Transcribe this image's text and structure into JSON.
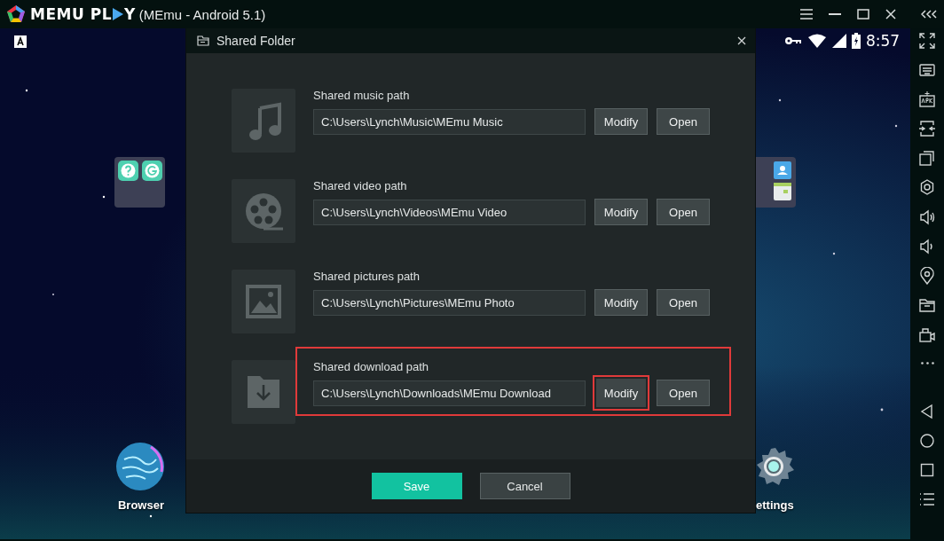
{
  "window": {
    "logo": {
      "before": "MEMU PL",
      "after": "Y"
    },
    "title": "(MEmu - Android 5.1)"
  },
  "status_bar": {
    "time": "8:57"
  },
  "home": {
    "apps": [
      {
        "kind": "browser",
        "label": "Browser"
      },
      {
        "kind": "settings",
        "label": "ettings"
      }
    ]
  },
  "dialog": {
    "title": "Shared Folder",
    "rows": [
      {
        "kind": "music",
        "label": "Shared music path",
        "path": "C:\\Users\\Lynch\\Music\\MEmu Music",
        "highlighted": false,
        "buttons": [
          {
            "label": "Modify",
            "highlighted": false
          },
          {
            "label": "Open",
            "highlighted": false
          }
        ]
      },
      {
        "kind": "video",
        "label": "Shared video path",
        "path": "C:\\Users\\Lynch\\Videos\\MEmu Video",
        "highlighted": false,
        "buttons": [
          {
            "label": "Modify",
            "highlighted": false
          },
          {
            "label": "Open",
            "highlighted": false
          }
        ]
      },
      {
        "kind": "pictures",
        "label": "Shared pictures path",
        "path": "C:\\Users\\Lynch\\Pictures\\MEmu Photo",
        "highlighted": false,
        "buttons": [
          {
            "label": "Modify",
            "highlighted": false
          },
          {
            "label": "Open",
            "highlighted": false
          }
        ]
      },
      {
        "kind": "download",
        "label": "Shared download path",
        "path": "C:\\Users\\Lynch\\Downloads\\MEmu Download",
        "highlighted": true,
        "buttons": [
          {
            "label": "Modify",
            "highlighted": true
          },
          {
            "label": "Open",
            "highlighted": false
          }
        ]
      }
    ],
    "buttons": [
      {
        "kind": "primary",
        "label": "Save"
      },
      {
        "kind": "secondary",
        "label": "Cancel"
      }
    ]
  }
}
